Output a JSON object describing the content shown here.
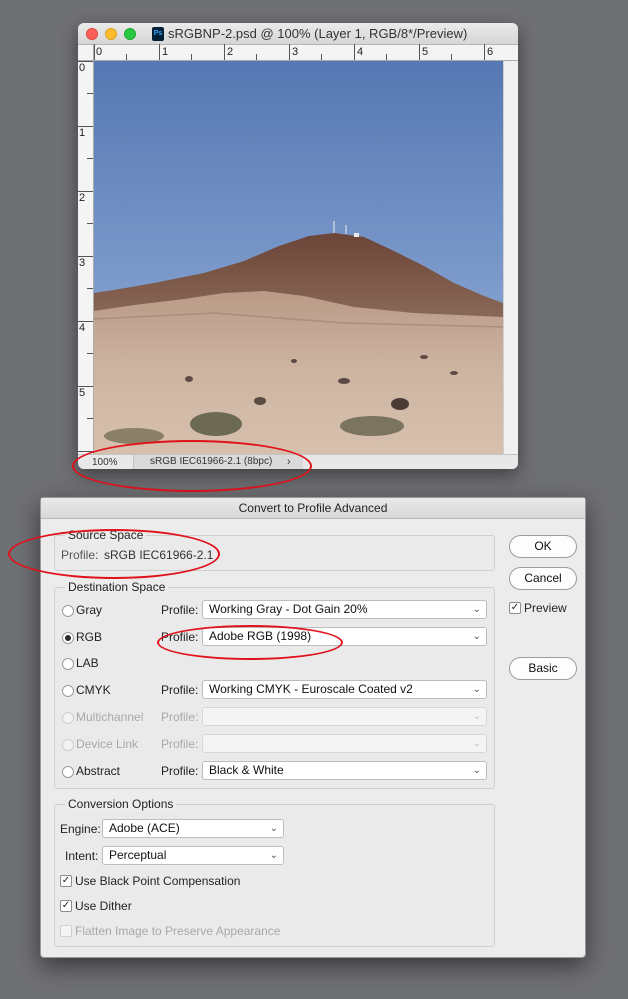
{
  "document": {
    "title": "sRGBNP-2.psd @ 100% (Layer 1, RGB/8*/Preview)",
    "app_badge": "Ps",
    "ruler_top_labels": [
      "0",
      "1",
      "2",
      "3",
      "4",
      "5",
      "6"
    ],
    "ruler_left_labels": [
      "0",
      "1",
      "2",
      "3",
      "4",
      "5"
    ],
    "status_bar": {
      "zoom": "100%",
      "info": "sRGB IEC61966-2.1 (8bpc)",
      "arrow": "›"
    }
  },
  "dialog": {
    "title": "Convert to Profile Advanced",
    "source_space": {
      "heading": "Source Space",
      "profile_label": "Profile:",
      "profile_value": "sRGB IEC61966-2.1"
    },
    "destination_space": {
      "heading": "Destination Space",
      "rows": [
        {
          "mode": "Gray",
          "profile_label": "Profile:",
          "profile": "Working Gray - Dot Gain 20%",
          "selected": false,
          "enabled": true
        },
        {
          "mode": "RGB",
          "profile_label": "Profile:",
          "profile": "Adobe RGB (1998)",
          "selected": true,
          "enabled": true
        },
        {
          "mode": "LAB",
          "profile_label": "",
          "profile": "",
          "selected": false,
          "enabled": true
        },
        {
          "mode": "CMYK",
          "profile_label": "Profile:",
          "profile": "Working CMYK - Euroscale Coated v2",
          "selected": false,
          "enabled": true
        },
        {
          "mode": "Multichannel",
          "profile_label": "Profile:",
          "profile": "",
          "selected": false,
          "enabled": false
        },
        {
          "mode": "Device Link",
          "profile_label": "Profile:",
          "profile": "",
          "selected": false,
          "enabled": false
        },
        {
          "mode": "Abstract",
          "profile_label": "Profile:",
          "profile": "Black & White",
          "selected": false,
          "enabled": true
        }
      ]
    },
    "conversion_options": {
      "heading": "Conversion Options",
      "engine_label": "Engine:",
      "engine_value": "Adobe (ACE)",
      "intent_label": "Intent:",
      "intent_value": "Perceptual",
      "black_point_compensation": {
        "label": "Use Black Point Compensation",
        "checked": true,
        "enabled": true
      },
      "use_dither": {
        "label": "Use Dither",
        "checked": true,
        "enabled": true
      },
      "flatten": {
        "label": "Flatten Image to Preserve Appearance",
        "checked": false,
        "enabled": false
      }
    },
    "buttons": {
      "ok": "OK",
      "cancel": "Cancel",
      "basic": "Basic"
    },
    "preview": {
      "label": "Preview",
      "checked": true
    }
  },
  "colors": {
    "annotation_red": "#e0121b",
    "sky_top": "#5677b2",
    "sky_bottom": "#9eb7d8",
    "mountain": "#7a5648",
    "ground": "#c9b09c"
  }
}
